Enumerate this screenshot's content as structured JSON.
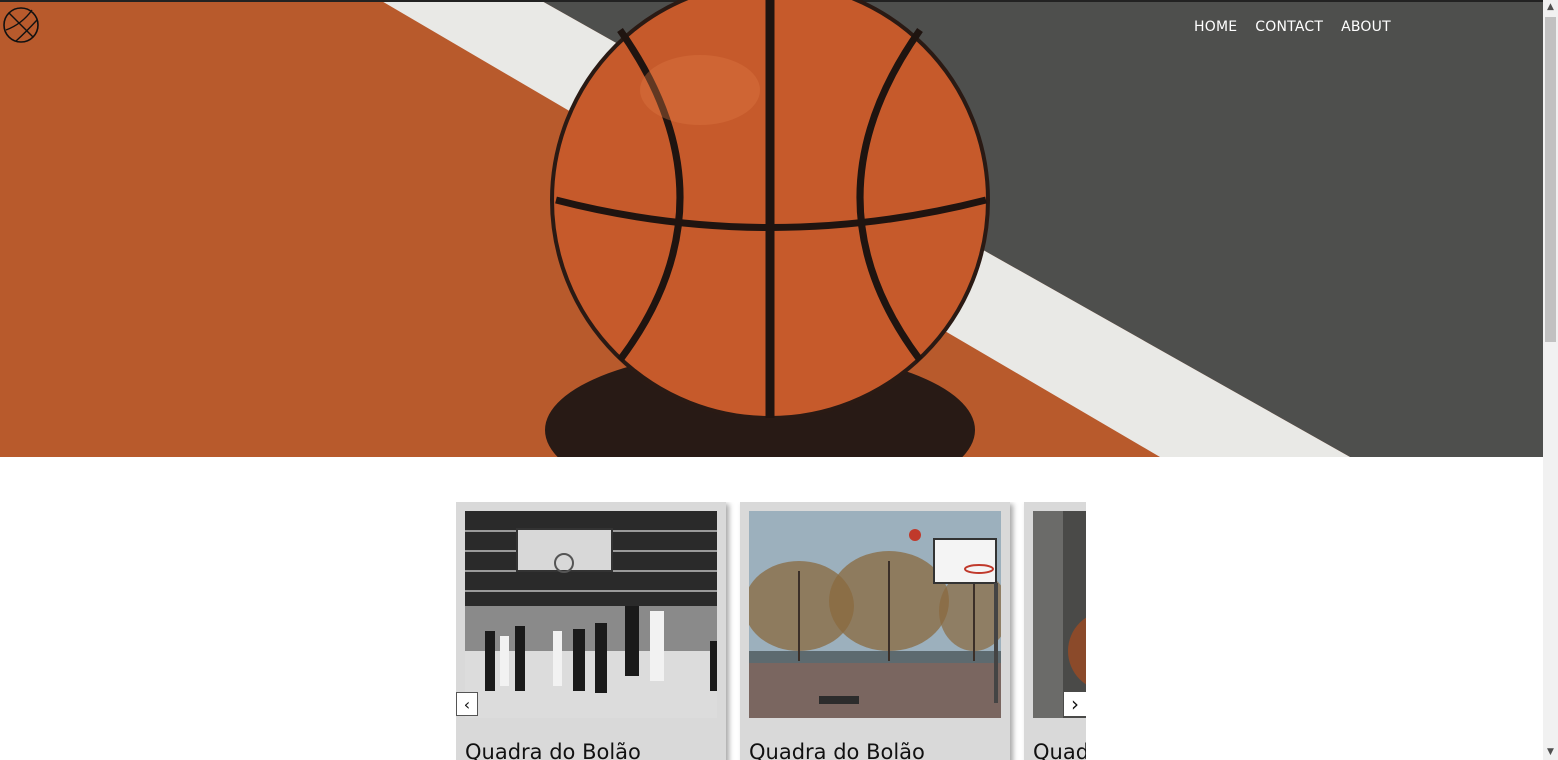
{
  "header": {
    "logo_icon": "basketball-icon",
    "nav": [
      {
        "label": "HOME"
      },
      {
        "label": "CONTACT"
      },
      {
        "label": "ABOUT"
      }
    ]
  },
  "hero": {
    "image": "basketball-on-court-photo",
    "colors": {
      "court_orange": "#b85a2c",
      "court_gray": "#4e4f4d",
      "line_white": "#e9e9e6",
      "ball": "#c65a2b"
    }
  },
  "carousel": {
    "prev_icon": "chevron-left-icon",
    "next_icon": "chevron-right-icon",
    "cards": [
      {
        "title": "Quadra do Bolão",
        "image": "indoor-basketball-game-bw-photo"
      },
      {
        "title": "Quadra do Bolão",
        "image": "outdoor-basketball-court-photo"
      },
      {
        "title": "Quadra do Bolão",
        "image": "basketball-closeup-photo"
      }
    ]
  },
  "scrollbar": {
    "up_icon": "scroll-up-arrow-icon",
    "down_icon": "scroll-down-arrow-icon"
  }
}
